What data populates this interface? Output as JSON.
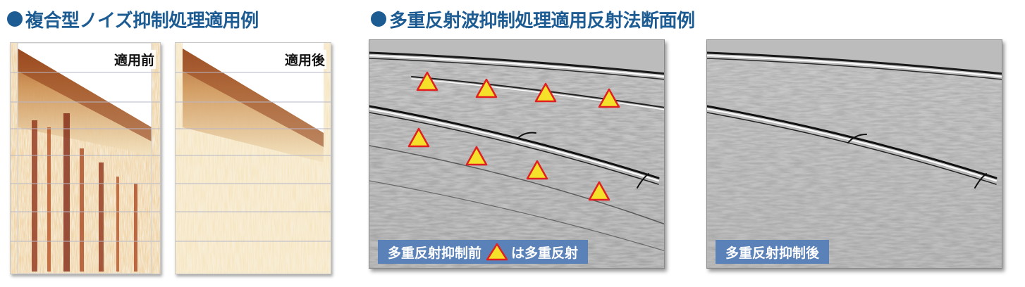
{
  "left_section": {
    "title": "複合型ノイズ抑制処理適用例",
    "panels": [
      {
        "label": "適用前"
      },
      {
        "label": "適用後"
      }
    ]
  },
  "right_section": {
    "title": "多重反射波抑制処理適用反射法断面例",
    "before_caption": {
      "text_a": "多重反射抑制前",
      "text_b": "は多重反射"
    },
    "after_caption": {
      "text": "多重反射抑制後"
    },
    "marker_count": 9
  },
  "colors": {
    "heading": "#1d5c93",
    "caption_bg": "#5b82b8",
    "marker_fill": "#f5e02a",
    "marker_stroke": "#e02020"
  }
}
